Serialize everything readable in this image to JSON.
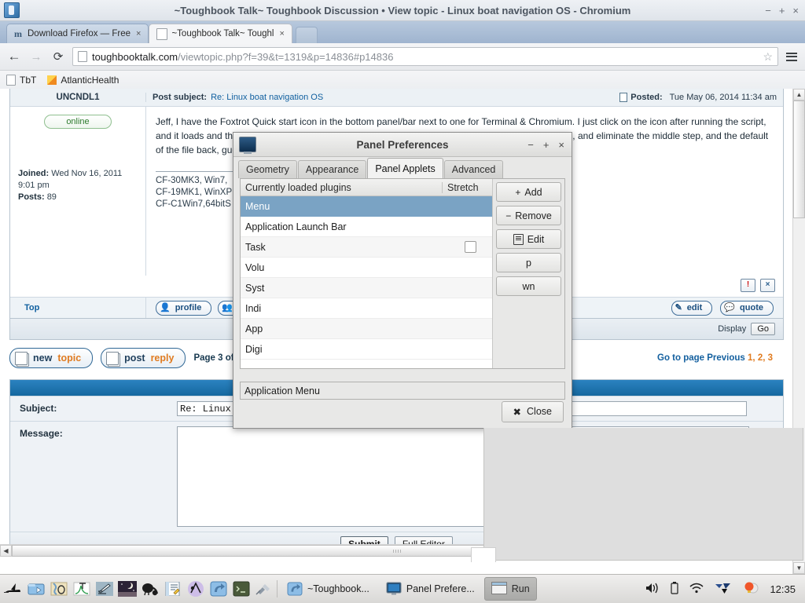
{
  "browser": {
    "window_title": "~Toughbook Talk~ Toughbook Discussion • View topic - Linux boat navigation OS - Chromium",
    "min_label": "−",
    "max_label": "+",
    "close_label": "×",
    "tabs": [
      {
        "label": "Download Firefox — Free",
        "favicon": "firefox-m-icon",
        "close": "×",
        "active": false
      },
      {
        "label": "~Toughbook Talk~ Toughl",
        "favicon": "page-icon",
        "close": "×",
        "active": true
      }
    ],
    "nav": {
      "back": "←",
      "forward": "→",
      "reload": "⟳"
    },
    "omnibox": {
      "host": "toughbooktalk.com",
      "path": "/viewtopic.php?f=39&t=1319&p=14836#p14836",
      "star": "☆"
    },
    "bookmarks": [
      {
        "label": "TbT",
        "icon": "page-icon"
      },
      {
        "label": "AtlanticHealth",
        "icon": "orange-folder-icon"
      }
    ]
  },
  "forum": {
    "post": {
      "author": "UNCNDL1",
      "subject_label": "Post subject:",
      "subject_link": "Re: Linux boat navigation OS",
      "posted_label": "Posted:",
      "posted_value": "Tue May 06, 2014 11:34 am",
      "online_badge": "online",
      "joined_label": "Joined:",
      "joined_value": "Wed Nov 16, 2011 9:01 pm",
      "posts_label": "Posts:",
      "posts_value": "89",
      "body": "Jeff, I have the Foxtrot Quick start icon in the bottom panel/bar next to one for Terminal & Chromium. I just click on the icon after running the script, and it loads and the default is my position, and back to maps. I like the idea of a script to do all three, and eliminate the middle step, and the default of the file back, guess we'll have to dig deeper and write our own Left",
      "signature": [
        "CF-30MK3, Win7,",
        "CF-19MK1, WinXP",
        "CF-C1Win7,64bitS"
      ],
      "report_icon": "!",
      "delete_icon": "×",
      "top_link": "Top",
      "profile_button": "profile",
      "pm_button": "",
      "edit_button": "edit",
      "quote_button": "quote"
    },
    "display_bar": {
      "text": "Display",
      "go_button": "Go"
    },
    "actions": {
      "new_topic_1": "new",
      "new_topic_2": "topic",
      "post_reply_1": "post",
      "post_reply_2": "reply",
      "page_info": "Page 3 of 3",
      "goto_label": "Go to page Previous",
      "goto_pages": "1, 2, 3"
    },
    "reply_form": {
      "subject_label": "Subject:",
      "subject_value": "Re: Linux",
      "message_label": "Message:",
      "message_value": "",
      "submit_button": "Submit",
      "full_editor_button": "Full Editor"
    }
  },
  "dialog": {
    "title": "Panel Preferences",
    "icon": "monitor-icon",
    "min_label": "−",
    "max_label": "+",
    "close_label": "×",
    "tabs": [
      {
        "label": "Geometry",
        "active": false
      },
      {
        "label": "Appearance",
        "active": false
      },
      {
        "label": "Panel Applets",
        "active": true
      },
      {
        "label": "Advanced",
        "active": false
      }
    ],
    "list_header": {
      "plugins": "Currently loaded plugins",
      "stretch": "Stretch"
    },
    "plugins": [
      {
        "label": "Menu",
        "selected": true
      },
      {
        "label": "Application Launch Bar",
        "selected": false
      },
      {
        "label": "Task",
        "selected": false
      },
      {
        "label": "Volu",
        "selected": false
      },
      {
        "label": "Syst",
        "selected": false
      },
      {
        "label": "Indi",
        "selected": false
      },
      {
        "label": "App",
        "selected": false
      },
      {
        "label": "Digi",
        "selected": false
      }
    ],
    "buttons": {
      "add": "Add",
      "add_icon": "+",
      "remove": "Remove",
      "remove_icon": "−",
      "edit": "Edit",
      "edit_icon": "edit-document-icon",
      "up": "p",
      "down": "wn"
    },
    "selected_item_name": "Application Menu",
    "close_button": "Close",
    "close_icon": "✖"
  },
  "taskbar": {
    "launchers": [
      "boat-icon",
      "file-manager-icon",
      "map-icon",
      "plot-icon",
      "editor-icon",
      "night-sky-icon",
      "kiwi-icon",
      "notes-icon",
      "navigation-icon",
      "blue-app-icon",
      "terminal-icon",
      "satellite-icon"
    ],
    "windows": [
      {
        "label": "~Toughbook...",
        "icon": "blue-app-icon",
        "active": false
      },
      {
        "label": "Panel Prefere...",
        "icon": "monitor-icon",
        "active": false
      },
      {
        "label": "Run",
        "icon": "window-icon",
        "active": true
      }
    ],
    "tray": [
      "volume-icon",
      "battery-icon",
      "wifi-icon",
      "network-icon",
      "brightness-icon"
    ],
    "clock": "12:35"
  }
}
